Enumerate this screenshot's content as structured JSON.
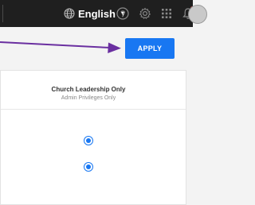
{
  "topbar": {
    "language_label": "English",
    "icons": [
      "globe-icon",
      "help-icon",
      "settings-icon",
      "apps-grid-icon",
      "notification-bell-icon",
      "avatar"
    ]
  },
  "actions": {
    "apply_label": "APPLY"
  },
  "permissions_table": {
    "column_title": "Church Leadership Only",
    "column_subtitle": "Admin Privileges Only",
    "rows": [
      {
        "selected": true
      },
      {
        "selected": true
      }
    ]
  },
  "colors": {
    "topbar_bg": "#1f1f1f",
    "accent": "#1877f2",
    "annotation_arrow": "#6a2fa0"
  }
}
